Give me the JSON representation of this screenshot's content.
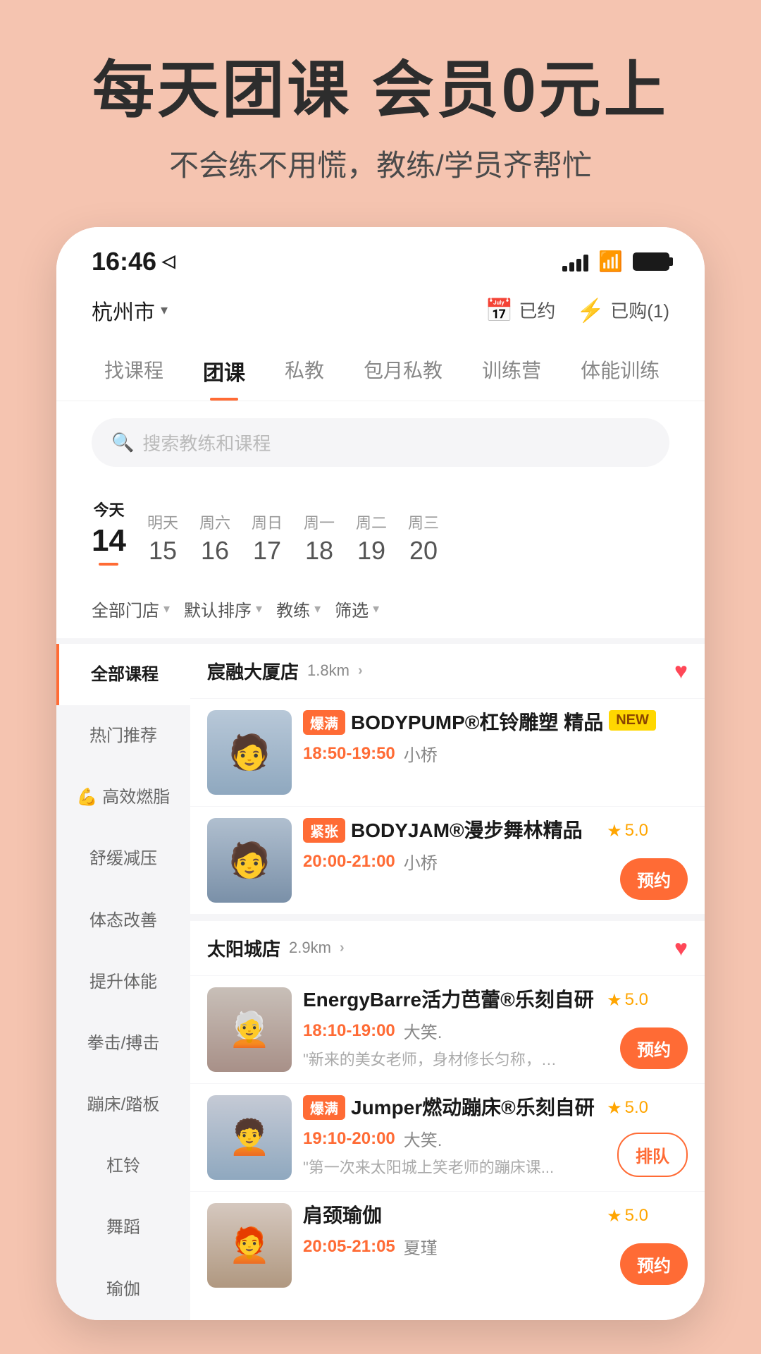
{
  "hero": {
    "title": "每天团课 会员0元上",
    "subtitle": "不会练不用慌，教练/学员齐帮忙"
  },
  "statusBar": {
    "time": "16:46",
    "navIcon": "◁"
  },
  "topNav": {
    "location": "杭州市",
    "booked": "已约",
    "purchased": "已购(1)"
  },
  "tabs": [
    {
      "label": "找课程",
      "active": false
    },
    {
      "label": "团课",
      "active": true
    },
    {
      "label": "私教",
      "active": false
    },
    {
      "label": "包月私教",
      "active": false
    },
    {
      "label": "训练营",
      "active": false
    },
    {
      "label": "体能训练",
      "active": false
    }
  ],
  "search": {
    "placeholder": "搜索教练和课程"
  },
  "dates": [
    {
      "label": "今天",
      "num": "14",
      "today": true
    },
    {
      "label": "明天",
      "num": "15",
      "today": false
    },
    {
      "label": "周六",
      "num": "16",
      "today": false
    },
    {
      "label": "周日",
      "num": "17",
      "today": false
    },
    {
      "label": "周一",
      "num": "18",
      "today": false
    },
    {
      "label": "周二",
      "num": "19",
      "today": false
    },
    {
      "label": "周三",
      "num": "20",
      "today": false
    }
  ],
  "filters": [
    {
      "label": "全部门店"
    },
    {
      "label": "默认排序"
    },
    {
      "label": "教练"
    },
    {
      "label": "筛选"
    }
  ],
  "sidebar": {
    "items": [
      {
        "label": "全部课程",
        "active": true
      },
      {
        "label": "热门推荐",
        "active": false
      },
      {
        "label": "💪 高效燃脂",
        "active": false
      },
      {
        "label": "舒缓减压",
        "active": false
      },
      {
        "label": "体态改善",
        "active": false
      },
      {
        "label": "提升体能",
        "active": false
      },
      {
        "label": "拳击/搏击",
        "active": false
      },
      {
        "label": "蹦床/踏板",
        "active": false
      },
      {
        "label": "杠铃",
        "active": false
      },
      {
        "label": "舞蹈",
        "active": false
      },
      {
        "label": "瑜伽",
        "active": false
      }
    ]
  },
  "stores": [
    {
      "name": "宸融大厦店",
      "distance": "1.8km",
      "favorited": true,
      "courses": [
        {
          "tag": "爆满",
          "tagType": "full",
          "badge": "NEW",
          "name": "BODYPUMP®杠铃雕塑 精品",
          "time": "18:50-19:50",
          "trainer": "小桥",
          "rating": null,
          "hasReserve": false,
          "hasQueue": false,
          "desc": null
        },
        {
          "tag": "紧张",
          "tagType": "tight",
          "badge": null,
          "name": "BODYJAM®漫步舞林精品",
          "time": "20:00-21:00",
          "trainer": "小桥",
          "rating": "5.0",
          "hasReserve": true,
          "hasQueue": false,
          "desc": null
        }
      ]
    },
    {
      "name": "太阳城店",
      "distance": "2.9km",
      "favorited": true,
      "courses": [
        {
          "tag": null,
          "tagType": null,
          "badge": null,
          "name": "EnergyBarre活力芭蕾®乐刻自研",
          "time": "18:10-19:00",
          "trainer": "大笑.",
          "rating": "5.0",
          "hasReserve": true,
          "hasQueue": false,
          "desc": "\"新来的美女老师，身材修长匀称，教..."
        },
        {
          "tag": "爆满",
          "tagType": "full",
          "badge": null,
          "name": "Jumper燃动蹦床®乐刻自研",
          "time": "19:10-20:00",
          "trainer": "大笑.",
          "rating": "5.0",
          "hasReserve": false,
          "hasQueue": true,
          "desc": "\"第一次来太阳城上笑老师的蹦床课..."
        },
        {
          "tag": null,
          "tagType": null,
          "badge": null,
          "name": "肩颈瑜伽",
          "time": "20:05-21:05",
          "trainer": "夏瑾",
          "rating": "5.0",
          "hasReserve": true,
          "hasQueue": false,
          "desc": null
        }
      ]
    }
  ],
  "labels": {
    "booked_icon": "📅",
    "purchased_icon": "⚡",
    "search_icon": "🔍",
    "all_courses": "全部课程",
    "reserve": "预约",
    "queue": "排队",
    "star": "★"
  }
}
